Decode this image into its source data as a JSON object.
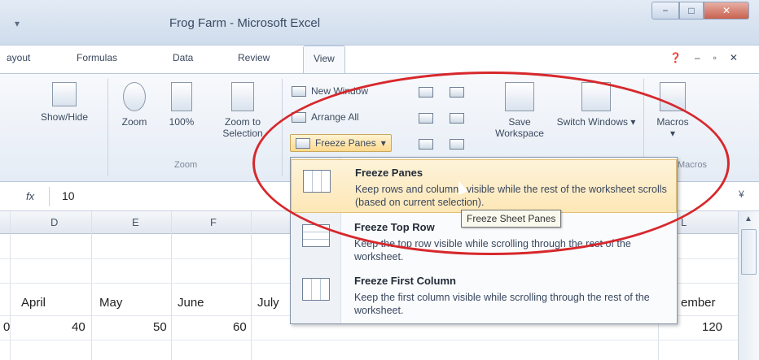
{
  "window": {
    "title": "Frog Farm - Microsoft Excel",
    "qa_arrow": "▾",
    "min": "−",
    "max": "□",
    "close": "✕"
  },
  "tabs": [
    {
      "label": "ayout"
    },
    {
      "label": "Formulas"
    },
    {
      "label": "Data"
    },
    {
      "label": "Review"
    },
    {
      "label": "View",
      "active": true
    }
  ],
  "tab_right": {
    "help": "❓",
    "min": "–",
    "restore": "▫",
    "close": "✕"
  },
  "ribbon": {
    "show_hide": "Show/Hide",
    "zoom": "Zoom",
    "zoom_100": "100%",
    "zoom_to_selection": "Zoom to Selection",
    "zoom_group": "Zoom",
    "new_window": "New Window",
    "arrange_all": "Arrange All",
    "freeze_panes": "Freeze Panes",
    "freeze_arrow": "▾",
    "save_workspace": "Save Workspace",
    "switch_windows": "Switch Windows",
    "switch_arrow": "▾",
    "macros": "Macros",
    "macros_arrow": "▾",
    "macros_group": "Macros"
  },
  "formula_bar": {
    "fx": "fx",
    "value": "10",
    "expand": "¥"
  },
  "columns": [
    "D",
    "E",
    "F",
    "L"
  ],
  "cells": {
    "row1": [
      "April",
      "May",
      "June",
      "July",
      "ember"
    ],
    "row2": [
      "0",
      "40",
      "50",
      "60",
      "120"
    ]
  },
  "dropdown": {
    "items": [
      {
        "title": "Freeze Panes",
        "desc": "Keep rows and columns visible while the rest of the worksheet scrolls (based on current selection)."
      },
      {
        "title": "Freeze Top Row",
        "desc": "Keep the top row visible while scrolling through the rest of the worksheet."
      },
      {
        "title": "Freeze First Column",
        "desc": "Keep the first column visible while scrolling through the rest of the worksheet."
      }
    ]
  },
  "tooltip": "Freeze Sheet Panes",
  "colors": {
    "highlight": "#d7282c",
    "hover": "#fde7b6"
  }
}
